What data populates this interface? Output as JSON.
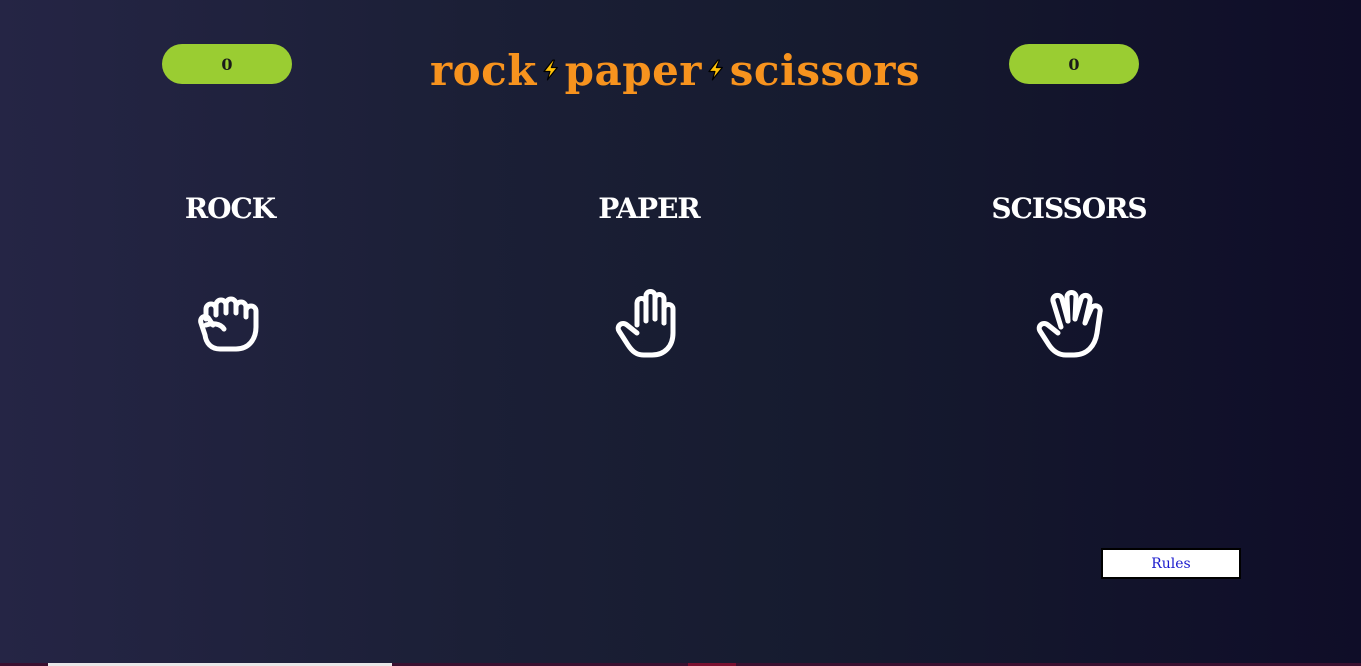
{
  "scores": {
    "player": "0",
    "computer": "0"
  },
  "header": {
    "title_rock": "rock",
    "title_paper": "paper",
    "title_scissors": "scissors",
    "separator_icon": "lightning-bolt-icon"
  },
  "choices": [
    {
      "label": "ROCK",
      "icon": "fist-icon"
    },
    {
      "label": "PAPER",
      "icon": "open-hand-icon"
    },
    {
      "label": "SCISSORS",
      "icon": "vulcan-salute-icon"
    }
  ],
  "rules_button": {
    "label": "Rules"
  },
  "colors": {
    "accent": "#f7931e",
    "score_pill": "#9acd32",
    "rules_text": "#1a1acd",
    "background_start": "#252545",
    "background_end": "#0f0d28"
  }
}
